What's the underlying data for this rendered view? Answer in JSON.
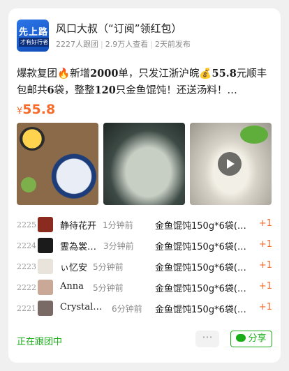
{
  "header": {
    "avatar_text_1": "先上路",
    "avatar_text_2": "才有好行者",
    "title": "风口大叔（“订阅”领红包）",
    "followers": "2227人跟团",
    "views": "2.9万人查看",
    "posted": "2天前发布"
  },
  "post": {
    "description_1": "爆款复团",
    "description_2": "新增",
    "description_3": "2000",
    "description_4": "单，只发江浙沪皖",
    "description_5": "55.8",
    "description_6": "元顺丰包邮共",
    "description_7": "6",
    "description_8": "袋，整整",
    "description_9": "120",
    "description_10": "只金鱼馄饨！还送汤料！…",
    "currency": "¥",
    "price": "55.8"
  },
  "photos": [
    {
      "name": "wonton-bowl-photo"
    },
    {
      "name": "wonton-closeup-photo"
    },
    {
      "name": "wonton-spoon-video",
      "video": true
    }
  ],
  "orders": [
    {
      "index": "2225",
      "name": "静待花开",
      "time": "1分钟前",
      "item": "金鱼馄饨150g*6袋(…",
      "qty": "+1",
      "avatar_color": "#8b2a1e"
    },
    {
      "index": "2224",
      "name": "霊為裳…",
      "time": "3分钟前",
      "item": "金鱼馄饨150g*6袋(…",
      "qty": "+1",
      "avatar_color": "#1b1b1b"
    },
    {
      "index": "2223",
      "name": "ぃ忆安",
      "time": "5分钟前",
      "item": "金鱼馄饨150g*6袋(…",
      "qty": "+1",
      "avatar_color": "#e8e4dc"
    },
    {
      "index": "2222",
      "name": "Anna",
      "time": "5分钟前",
      "item": "金鱼馄饨150g*6袋(…",
      "qty": "+1",
      "avatar_color": "#c9a898"
    },
    {
      "index": "2221",
      "name": "Crystal…",
      "time": "6分钟前",
      "item": "金鱼馄饨150g*6袋(…",
      "qty": "+1",
      "avatar_color": "#7a6a66"
    }
  ],
  "footer": {
    "following_label": "正在跟团中",
    "more_label": "···",
    "share_label": "分享"
  },
  "colors": {
    "accent_orange": "#f56b2a",
    "wechat_green": "#1aad19"
  }
}
